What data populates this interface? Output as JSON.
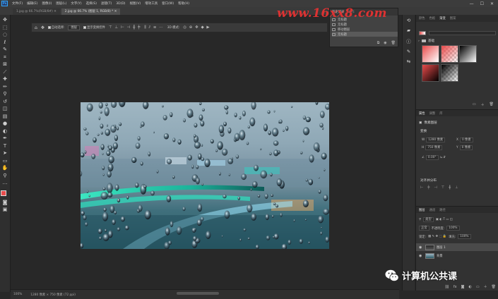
{
  "menubar": {
    "app_badge": "Ps",
    "items": [
      "文件(F)",
      "编辑(E)",
      "图像(I)",
      "图层(L)",
      "文字(Y)",
      "选择(S)",
      "滤镜(T)",
      "3D(D)",
      "视图(V)",
      "增效工具",
      "窗口(W)",
      "帮助(H)"
    ],
    "win_controls": [
      "—",
      "☐",
      "✕"
    ]
  },
  "tabs": [
    {
      "label": "1.jpg @ 66.7%(RGB/8#) ✕",
      "active": false
    },
    {
      "label": "2.jpg @ 66.7% (图层 1, RGB/8) * ✕",
      "active": true
    }
  ],
  "watermark": "www.16xx8.com",
  "options": {
    "auto_select_label": "自动选择:",
    "auto_select_target": "图层",
    "show_transform_label": "显示变换控件",
    "mode_3d": "3D 模式:"
  },
  "history": {
    "tabs": [
      "历史记录",
      "动作"
    ],
    "rows": [
      {
        "label": "无标题",
        "selected": false
      },
      {
        "label": "无标题",
        "selected": false
      },
      {
        "label": "移动图层",
        "selected": false
      },
      {
        "label": "无标题",
        "selected": true
      }
    ]
  },
  "gradients": {
    "tabs": [
      "颜色",
      "色板",
      "渐变",
      "图案"
    ],
    "active_tab": "渐变",
    "folder": "基础",
    "tiles": [
      "#e84b4b→#ffffff",
      "#e84b4b→transparent",
      "#000→#fff",
      "#e84b4b→#000",
      "#000→transparent"
    ]
  },
  "properties": {
    "tabs": [
      "属性",
      "调整",
      "库"
    ],
    "title": "像素图层",
    "sub": "变换",
    "w_label": "W",
    "w_value": "1280 像素",
    "h_label": "H",
    "h_value": "750 像素",
    "x_label": "X",
    "x_value": "0 像素",
    "y_label": "Y",
    "y_value": "0 像素",
    "angle_value": "0.00°",
    "align_title": "对齐并分布"
  },
  "layers": {
    "tabs": [
      "图层",
      "通道",
      "路径"
    ],
    "kind_label": "类型",
    "blend_mode": "正常",
    "opacity_label": "不透明度:",
    "opacity_value": "100%",
    "lock_label": "锁定:",
    "fill_label": "填充:",
    "fill_value": "100%",
    "items": [
      {
        "name": "图层 1",
        "selected": true
      },
      {
        "name": "背景",
        "selected": false
      }
    ]
  },
  "status": {
    "zoom": "100%",
    "doc_info": "1280 像素 × 750 像素 (72 ppi)"
  },
  "brand": {
    "text": "计算机公共课"
  }
}
